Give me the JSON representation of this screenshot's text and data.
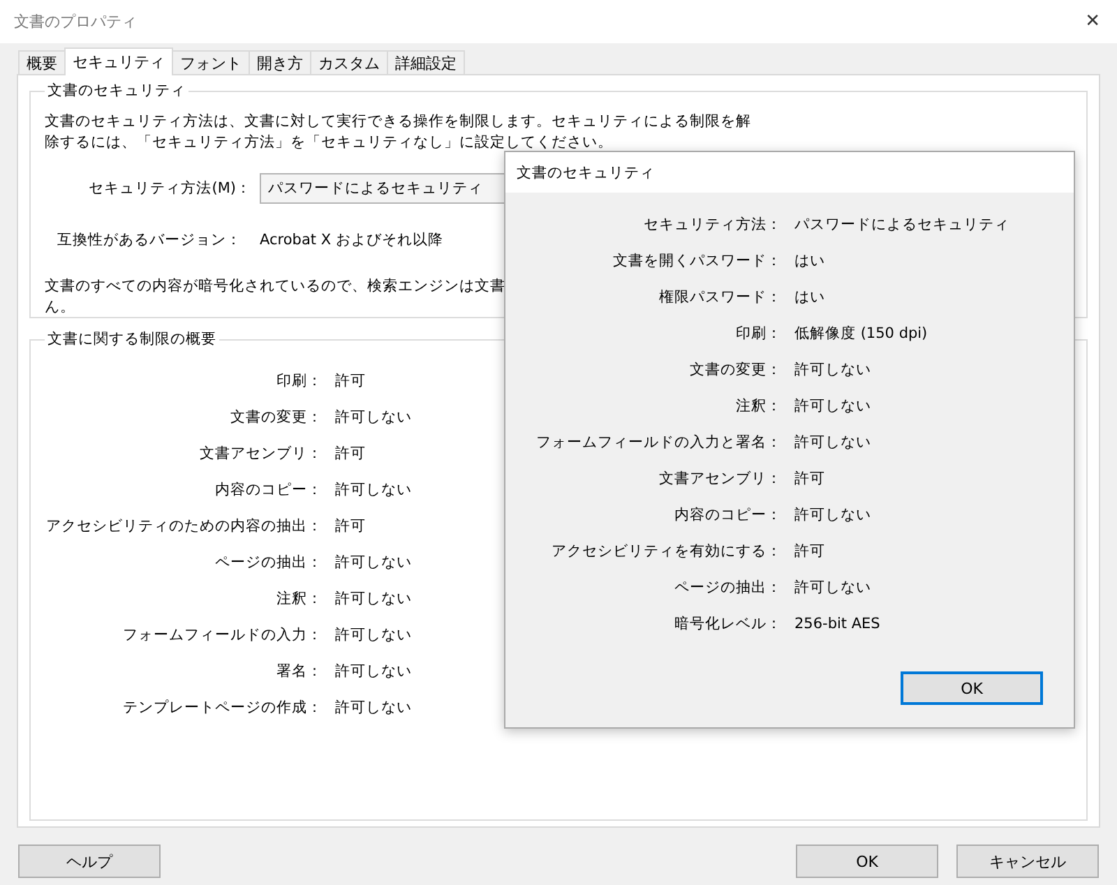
{
  "window": {
    "title": "文書のプロパティ",
    "close": "✕"
  },
  "tabs": [
    {
      "label": "概要",
      "selected": false
    },
    {
      "label": "セキュリティ",
      "selected": true
    },
    {
      "label": "フォント",
      "selected": false
    },
    {
      "label": "開き方",
      "selected": false
    },
    {
      "label": "カスタム",
      "selected": false
    },
    {
      "label": "詳細設定",
      "selected": false
    }
  ],
  "security_group": {
    "title": "文書のセキュリティ",
    "description_lines": [
      "文書のセキュリティ方法は、文書に対して実行できる操作を制限します。セキュリティによる制限を解",
      "除するには、「セキュリティ方法」を「セキュリティなし」に設定してください。"
    ],
    "method_label": "セキュリティ方法(M)：",
    "method_value": "パスワードによるセキュリティ",
    "compat_label": "互換性があるバージョン：",
    "compat_value": "Acrobat X およびそれ以降",
    "note_lines": [
      "文書のすべての内容が暗号化されているので、検索エンジンは文書",
      "ん。"
    ]
  },
  "restrictions_group": {
    "title": "文書に関する制限の概要",
    "rows": [
      {
        "label": "印刷：",
        "value": "許可"
      },
      {
        "label": "文書の変更：",
        "value": "許可しない"
      },
      {
        "label": "文書アセンブリ：",
        "value": "許可"
      },
      {
        "label": "内容のコピー：",
        "value": "許可しない"
      },
      {
        "label": "アクセシビリティのための内容の抽出：",
        "value": "許可"
      },
      {
        "label": "ページの抽出：",
        "value": "許可しない"
      },
      {
        "label": "注釈：",
        "value": "許可しない"
      },
      {
        "label": "フォームフィールドの入力：",
        "value": "許可しない"
      },
      {
        "label": "署名：",
        "value": "許可しない"
      },
      {
        "label": "テンプレートページの作成：",
        "value": "許可しない"
      }
    ]
  },
  "buttons": {
    "help": "ヘルプ",
    "ok": "OK",
    "cancel": "キャンセル"
  },
  "dialog": {
    "title": "文書のセキュリティ",
    "rows": [
      {
        "label": "セキュリティ方法：",
        "value": "パスワードによるセキュリティ"
      },
      {
        "label": "文書を開くパスワード：",
        "value": "はい"
      },
      {
        "label": "権限パスワード：",
        "value": "はい"
      },
      {
        "label": "印刷：",
        "value": "低解像度 (150 dpi)"
      },
      {
        "label": "文書の変更：",
        "value": "許可しない"
      },
      {
        "label": "注釈：",
        "value": "許可しない"
      },
      {
        "label": "フォームフィールドの入力と署名：",
        "value": "許可しない"
      },
      {
        "label": "文書アセンブリ：",
        "value": "許可"
      },
      {
        "label": "内容のコピー：",
        "value": "許可しない"
      },
      {
        "label": "アクセシビリティを有効にする：",
        "value": "許可"
      },
      {
        "label": "ページの抽出：",
        "value": "許可しない"
      },
      {
        "label": "暗号化レベル：",
        "value": "256-bit AES"
      }
    ],
    "ok": "OK"
  }
}
